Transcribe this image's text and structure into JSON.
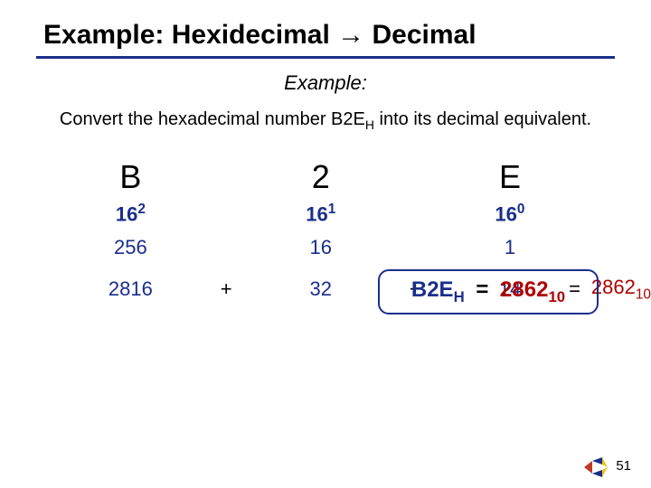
{
  "title": "Example: Hexidecimal → Decimal",
  "subheading": "Example:",
  "prompt_a": "Convert the hexadecimal number B2E",
  "prompt_sub": "H",
  "prompt_b": " into its decimal equivalent.",
  "digits": {
    "d0": "B",
    "d1": "2",
    "d2": "E"
  },
  "pow": {
    "b0": "16",
    "e0": "2",
    "b1": "16",
    "e1": "1",
    "b2": "16",
    "e2": "0"
  },
  "vals": {
    "v0": "256",
    "v1": "16",
    "v2": "1"
  },
  "sum": {
    "s0": "2816",
    "op0": "+",
    "s1": "32",
    "op1": "+",
    "s2": "14",
    "eq": "="
  },
  "result_base": "2862",
  "result_sub": "10",
  "box": {
    "hex": "B2E",
    "hex_sub": "H",
    "eq": "=",
    "dec": "2862",
    "dec_sub": "10"
  },
  "page": "51"
}
